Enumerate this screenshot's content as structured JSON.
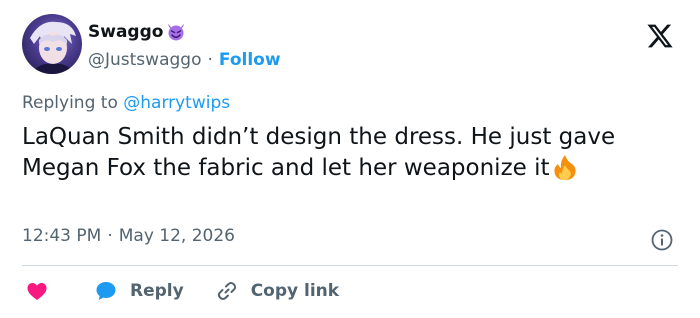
{
  "author": {
    "display_name": "Swaggo",
    "name_emoji": "smiling-face-with-horns-icon",
    "handle": "@Justswaggo",
    "separator": "·",
    "follow_label": "Follow"
  },
  "reply_context": {
    "prefix": "Replying to",
    "mention": "@harrytwips"
  },
  "tweet": {
    "text": "LaQuan Smith didn’t design the dress. He just gave Megan Fox the fabric and let her weaponize it",
    "trailing_emoji": "fire-icon",
    "time": "12:43 PM",
    "separator": "·",
    "date": "May 12, 2026"
  },
  "actions": {
    "reply_label": "Reply",
    "copy_link_label": "Copy link"
  },
  "colors": {
    "accent": "#1d9bf0",
    "secondary_text": "#536471",
    "like_red": "#f91880",
    "divider": "#cfd9de"
  }
}
